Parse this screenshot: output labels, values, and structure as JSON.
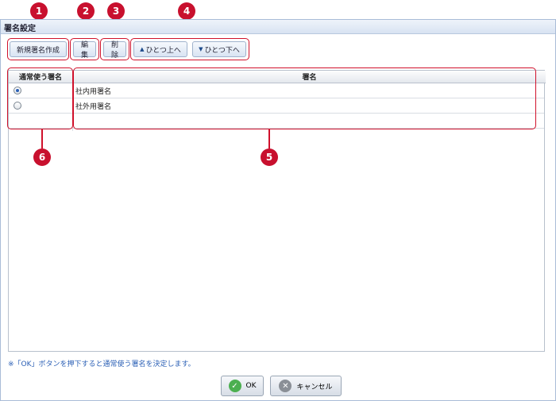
{
  "dialog": {
    "title": "署名設定"
  },
  "toolbar": {
    "new_label": "新規署名作成",
    "edit_label": "編集",
    "delete_label": "削除",
    "up_label": "ひとつ上へ",
    "down_label": "ひとつ下へ"
  },
  "markers": [
    "1",
    "2",
    "3",
    "4",
    "5",
    "6"
  ],
  "grid": {
    "headers": {
      "default": "通常使う署名",
      "signature": "署名"
    },
    "rows": [
      {
        "signature": "社内用署名",
        "selected": true
      },
      {
        "signature": "社外用署名",
        "selected": false
      }
    ]
  },
  "note": "※「OK」ボタンを押下すると通常使う署名を決定します。",
  "footer": {
    "ok_label": "OK",
    "cancel_label": "キャンセル"
  },
  "colors": {
    "marker": "#c8102e",
    "accent": "#2a5fb5",
    "ok": "#4caf50"
  }
}
